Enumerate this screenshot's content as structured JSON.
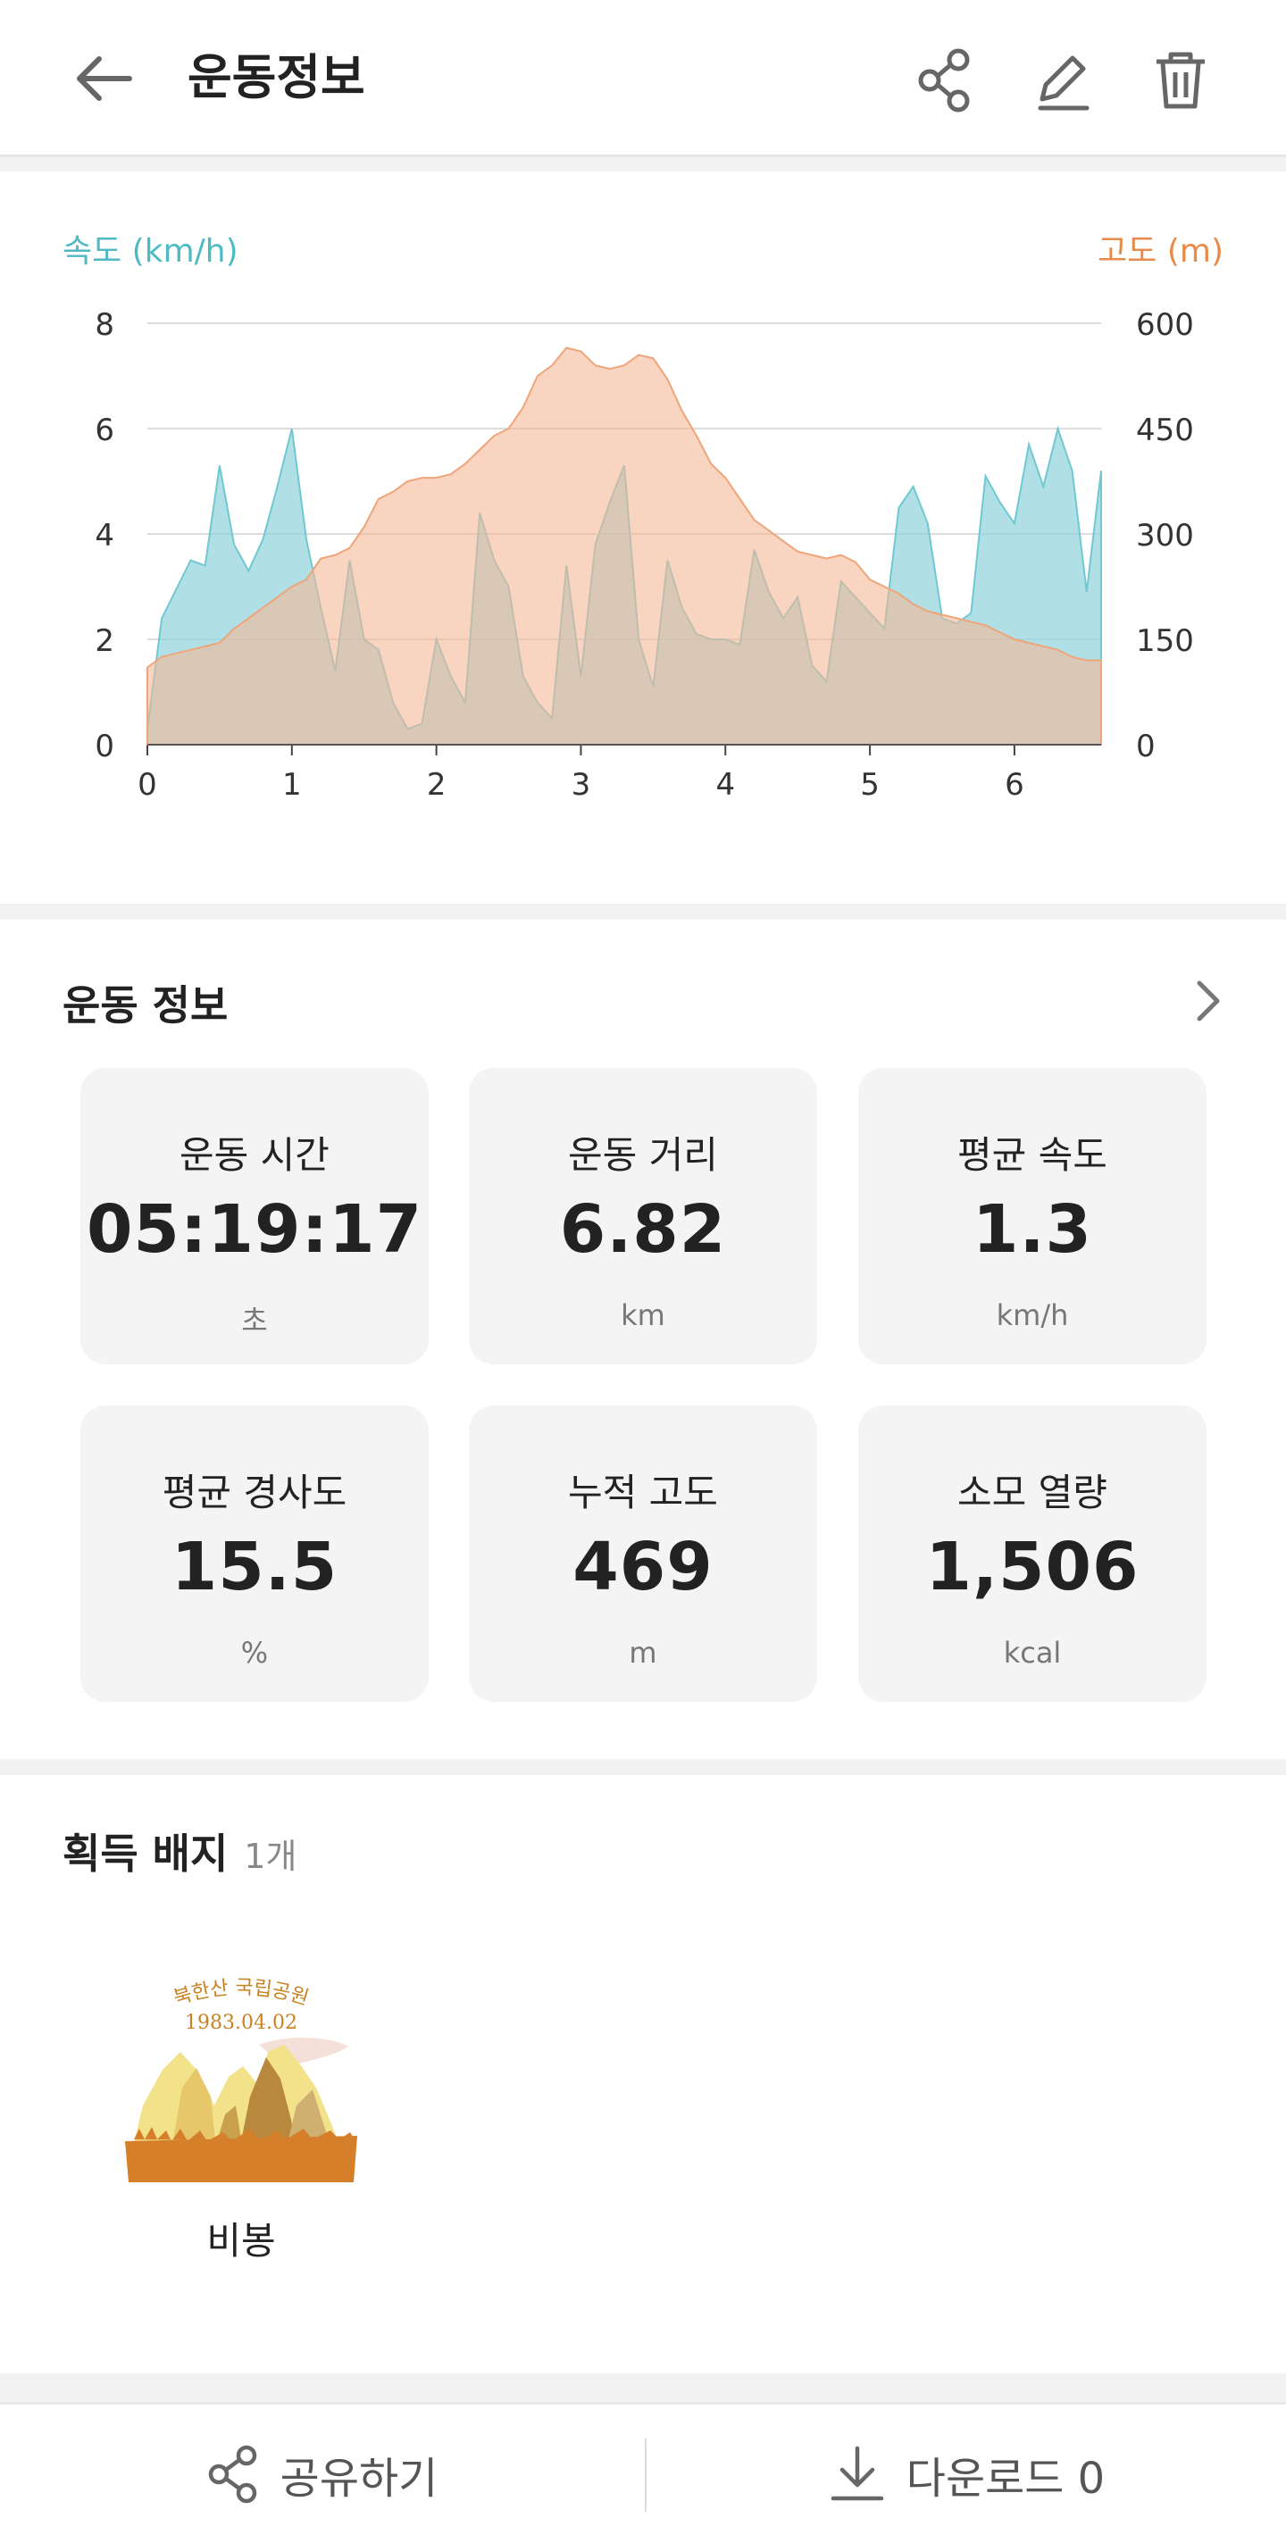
{
  "header": {
    "title": "운동정보",
    "back_icon": "arrow-left-icon",
    "actions": [
      "share-icon",
      "edit-icon",
      "trash-icon"
    ]
  },
  "chart_data": {
    "type": "area",
    "left_axis_label": "속도 (km/h)",
    "right_axis_label": "고도 (m)",
    "xlim": [
      0,
      6.6
    ],
    "y_left_lim": [
      0,
      8
    ],
    "y_right_lim": [
      0,
      600
    ],
    "x_ticks": [
      "0",
      "1",
      "2",
      "3",
      "4",
      "5",
      "6"
    ],
    "y_left_ticks": [
      "0",
      "2",
      "4",
      "6",
      "8"
    ],
    "y_right_ticks": [
      "0",
      "150",
      "300",
      "450",
      "600"
    ],
    "grid": true,
    "series": [
      {
        "axis": "left",
        "color": "#8fd3dc",
        "x": [
          0,
          0.1,
          0.3,
          0.4,
          0.5,
          0.6,
          0.7,
          0.8,
          0.9,
          1.0,
          1.1,
          1.2,
          1.3,
          1.4,
          1.5,
          1.6,
          1.7,
          1.8,
          1.9,
          2.0,
          2.1,
          2.2,
          2.3,
          2.4,
          2.5,
          2.6,
          2.7,
          2.8,
          2.9,
          3.0,
          3.1,
          3.2,
          3.3,
          3.4,
          3.5,
          3.6,
          3.7,
          3.8,
          3.9,
          4.0,
          4.1,
          4.2,
          4.3,
          4.4,
          4.5,
          4.6,
          4.7,
          4.8,
          4.9,
          5.0,
          5.1,
          5.2,
          5.3,
          5.4,
          5.5,
          5.6,
          5.7,
          5.8,
          5.9,
          6.0,
          6.1,
          6.2,
          6.3,
          6.4,
          6.5,
          6.6
        ],
        "values": [
          0.3,
          2.4,
          3.5,
          3.4,
          5.3,
          3.8,
          3.3,
          3.9,
          4.9,
          6.0,
          3.9,
          2.6,
          1.4,
          3.5,
          2.0,
          1.8,
          0.8,
          0.3,
          0.4,
          2.0,
          1.3,
          0.8,
          4.4,
          3.5,
          3.0,
          1.3,
          0.8,
          0.5,
          3.4,
          1.3,
          3.8,
          4.6,
          5.3,
          2.0,
          1.1,
          3.5,
          2.6,
          2.1,
          2.0,
          2.0,
          1.9,
          3.7,
          2.9,
          2.4,
          2.8,
          1.5,
          1.2,
          3.1,
          2.8,
          2.5,
          2.2,
          4.5,
          4.9,
          4.2,
          2.4,
          2.3,
          2.5,
          5.1,
          4.6,
          4.2,
          5.7,
          4.9,
          6.0,
          5.2,
          2.9,
          5.2
        ]
      },
      {
        "axis": "right",
        "color": "#f5b896",
        "x": [
          0,
          0.1,
          0.2,
          0.3,
          0.4,
          0.5,
          0.6,
          0.7,
          0.8,
          0.9,
          1.0,
          1.1,
          1.2,
          1.3,
          1.4,
          1.5,
          1.6,
          1.7,
          1.8,
          1.9,
          2.0,
          2.1,
          2.2,
          2.3,
          2.4,
          2.5,
          2.6,
          2.7,
          2.8,
          2.9,
          3.0,
          3.1,
          3.2,
          3.3,
          3.4,
          3.5,
          3.6,
          3.7,
          3.8,
          3.9,
          4.0,
          4.1,
          4.2,
          4.3,
          4.4,
          4.5,
          4.6,
          4.7,
          4.8,
          4.9,
          5.0,
          5.1,
          5.2,
          5.3,
          5.4,
          5.5,
          5.6,
          5.7,
          5.8,
          5.9,
          6.0,
          6.1,
          6.2,
          6.3,
          6.4,
          6.5,
          6.6
        ],
        "values": [
          110,
          125,
          130,
          135,
          140,
          145,
          165,
          180,
          195,
          210,
          225,
          235,
          265,
          270,
          280,
          310,
          350,
          360,
          375,
          380,
          380,
          385,
          400,
          420,
          440,
          450,
          480,
          525,
          540,
          565,
          560,
          540,
          535,
          540,
          555,
          550,
          520,
          475,
          440,
          400,
          380,
          350,
          320,
          305,
          290,
          275,
          270,
          265,
          270,
          260,
          235,
          225,
          215,
          200,
          190,
          185,
          180,
          175,
          170,
          160,
          150,
          145,
          140,
          135,
          125,
          120,
          120
        ]
      }
    ]
  },
  "workout": {
    "title": "운동 정보",
    "chevron_icon": "chevron-right-icon",
    "stats": [
      {
        "label": "운동 시간",
        "value": "05:19:17",
        "unit": "초"
      },
      {
        "label": "운동 거리",
        "value": "6.82",
        "unit": "km"
      },
      {
        "label": "평균 속도",
        "value": "1.3",
        "unit": "km/h"
      },
      {
        "label": "평균 경사도",
        "value": "15.5",
        "unit": "%"
      },
      {
        "label": "누적 고도",
        "value": "469",
        "unit": "m"
      },
      {
        "label": "소모 열량",
        "value": "1,506",
        "unit": "kcal"
      }
    ]
  },
  "badges": {
    "title": "획득 배지",
    "count": "1개",
    "items": [
      {
        "name": "비봉",
        "badge_text_line1": "북한산 국립공원",
        "badge_text_line2": "1983.04.02"
      }
    ]
  },
  "bottom_bar": {
    "share_label": "공유하기",
    "share_icon": "share-icon",
    "download_label": "다운로드 0",
    "download_icon": "download-icon"
  }
}
